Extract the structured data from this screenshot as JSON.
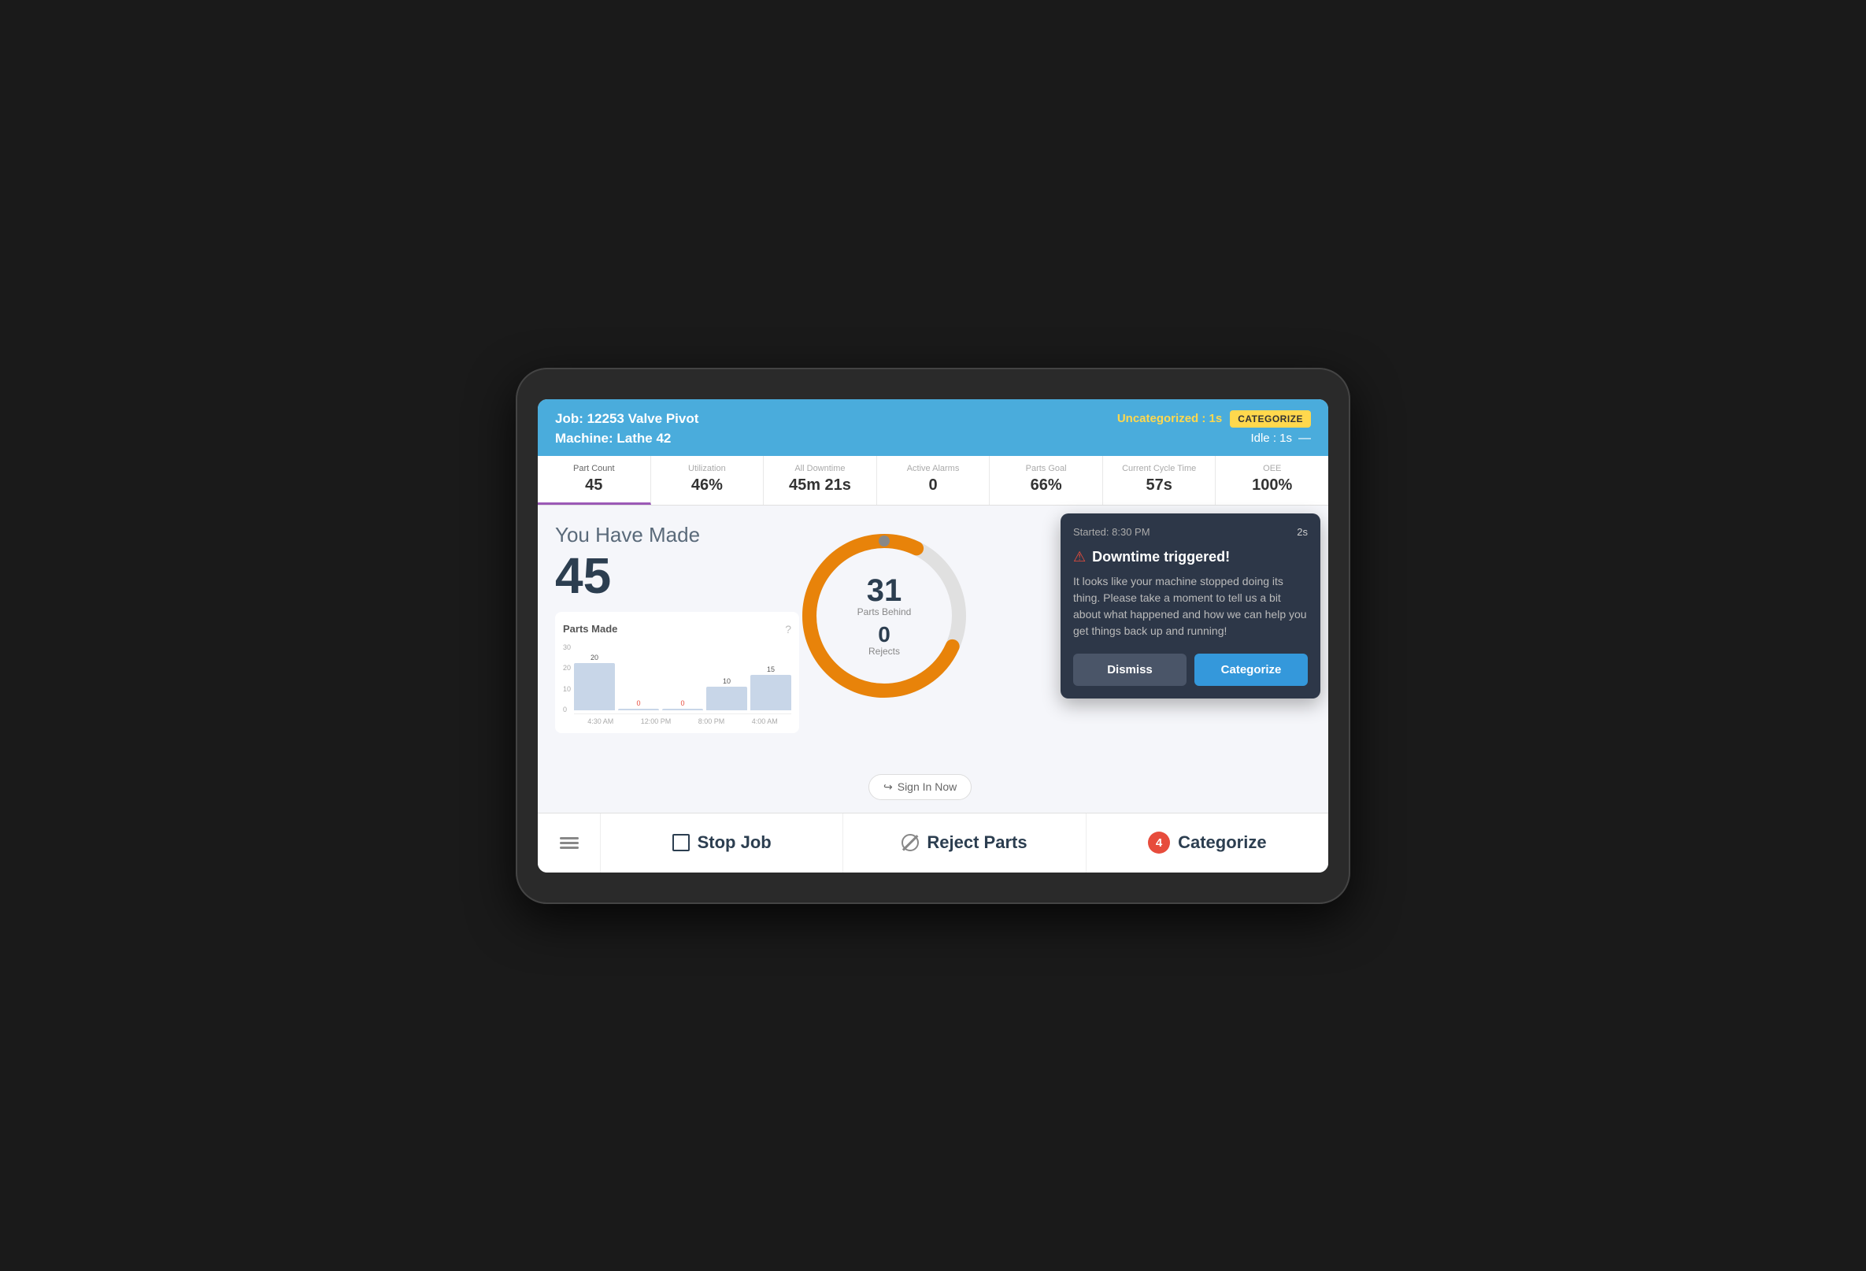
{
  "header": {
    "job_label": "Job: 12253 Valve Pivot",
    "machine_label": "Machine: Lathe 42",
    "status_uncategorized": "Uncategorized : 1s",
    "categorize_btn": "CATEGORIZE",
    "status_idle": "Idle : 1s"
  },
  "stats": [
    {
      "label": "Part Count",
      "value": "45",
      "active": true
    },
    {
      "label": "Utilization",
      "value": "46%"
    },
    {
      "label": "All Downtime",
      "value": "45m 21s"
    },
    {
      "label": "Active Alarms",
      "value": "0"
    },
    {
      "label": "Parts Goal",
      "value": "66%"
    },
    {
      "label": "Current Cycle Time",
      "value": "57s"
    },
    {
      "label": "OEE",
      "value": "100%"
    }
  ],
  "main": {
    "you_have_made": "You Have Made",
    "made_count": "45",
    "chart_title": "Parts Made",
    "chart_bars": [
      {
        "value": 20,
        "label": "20",
        "red": false
      },
      {
        "value": 0,
        "label": "0",
        "red": true
      },
      {
        "value": 0,
        "label": "0",
        "red": true
      },
      {
        "value": 10,
        "label": "10",
        "red": false
      },
      {
        "value": 15,
        "label": "15",
        "red": false
      }
    ],
    "chart_max": 30,
    "chart_x_labels": [
      "4:30 AM",
      "12:00 PM",
      "8:00 PM",
      "4:00 AM"
    ],
    "donut": {
      "parts_behind": "31",
      "parts_behind_label": "Parts Behind",
      "rejects": "0",
      "rejects_label": "Rejects"
    },
    "sign_in_btn": "Sign In Now"
  },
  "popup": {
    "started": "Started: 8:30 PM",
    "time": "2s",
    "title": "Downtime triggered!",
    "body": "It looks like your machine stopped doing its thing. Please take a moment to tell us a bit about what happened and how we can help you get things back up and running!",
    "dismiss_btn": "Dismiss",
    "categorize_btn": "Categorize"
  },
  "bottom_bar": {
    "menu_icon": "☰",
    "stop_job": "Stop Job",
    "reject_parts": "Reject Parts",
    "categorize": "Categorize",
    "categorize_count": "4"
  },
  "colors": {
    "header_bg": "#4aacdc",
    "accent_yellow": "#ffd84d",
    "active_tab": "#9b59b6",
    "donut_fill": "#e8830a",
    "donut_bg": "#e0e0e0",
    "popup_bg": "#2d3748",
    "categorize_blue": "#3498db",
    "badge_red": "#e74c3c"
  }
}
